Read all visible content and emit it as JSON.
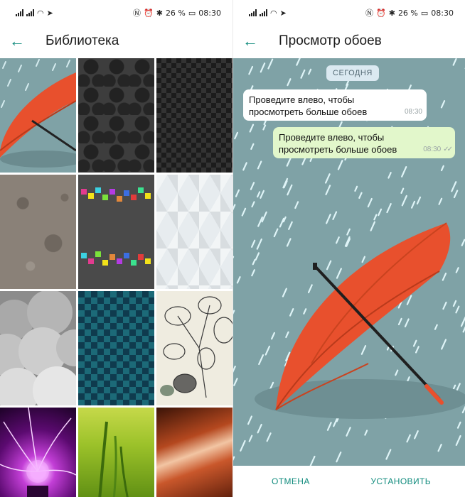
{
  "status": {
    "time": "08:30",
    "battery": "26 %"
  },
  "library": {
    "title": "Библиотека"
  },
  "wallpapers": [
    {
      "name": "umbrella"
    },
    {
      "name": "damask"
    },
    {
      "name": "diamond"
    },
    {
      "name": "moon"
    },
    {
      "name": "pixels"
    },
    {
      "name": "cubes"
    },
    {
      "name": "clouds"
    },
    {
      "name": "blue-check"
    },
    {
      "name": "leaves"
    },
    {
      "name": "plasma"
    },
    {
      "name": "grass"
    },
    {
      "name": "canyon"
    }
  ],
  "preview": {
    "title": "Просмотр обоев",
    "date_chip": "СЕГОДНЯ",
    "incoming": {
      "line1": "Проведите влево, чтобы",
      "line2": "просмотреть больше обоев",
      "time": "08:30"
    },
    "outgoing": {
      "line1": "Проведите влево, чтобы",
      "line2": "просмотреть больше обоев",
      "time": "08:30"
    },
    "cancel_label": "ОТМЕНА",
    "set_label": "УСТАНОВИТЬ"
  },
  "colors": {
    "accent": "#128c7e",
    "wallpaper_bg": "#7fa2a6",
    "umbrella": "#e8502d",
    "rain": "#dff4f7",
    "outgoing_bubble": "#e2f7cb"
  },
  "icons": [
    "back-arrow-icon",
    "signal-icon",
    "wifi-icon",
    "telegram-icon",
    "nfc-icon",
    "alarm-icon",
    "bluetooth-icon",
    "battery-icon",
    "double-check-icon"
  ]
}
